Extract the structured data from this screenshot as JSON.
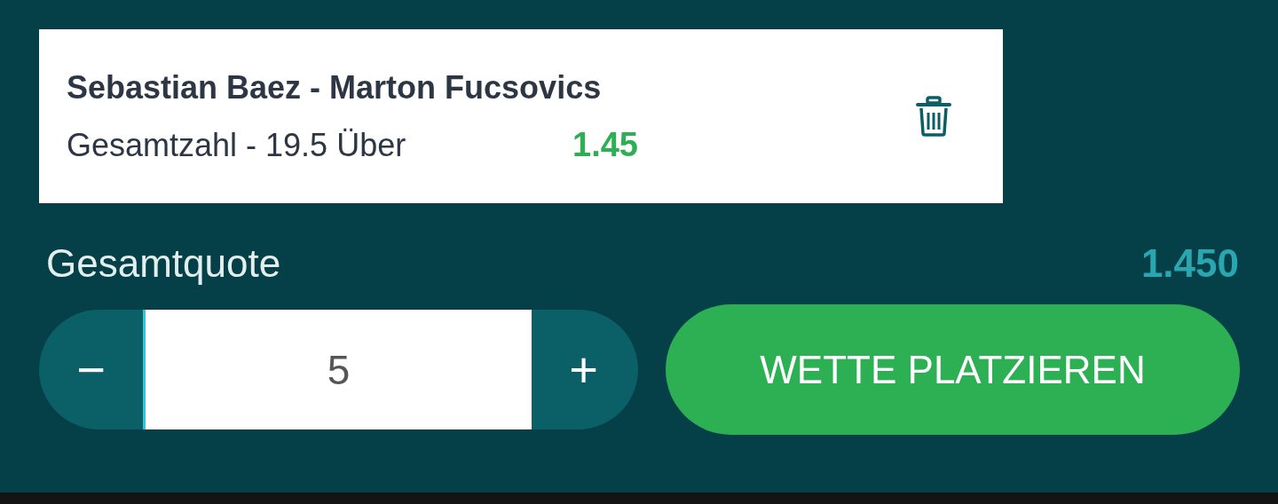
{
  "bet": {
    "match": "Sebastian Baez - Marton Fucsovics",
    "market": "Gesamtzahl - 19.5 Über",
    "odds": "1.45"
  },
  "total": {
    "label": "Gesamtquote",
    "value": "1.450"
  },
  "stake": {
    "minus": "−",
    "value": "5",
    "plus": "+"
  },
  "submit": "WETTE PLATZIEREN"
}
